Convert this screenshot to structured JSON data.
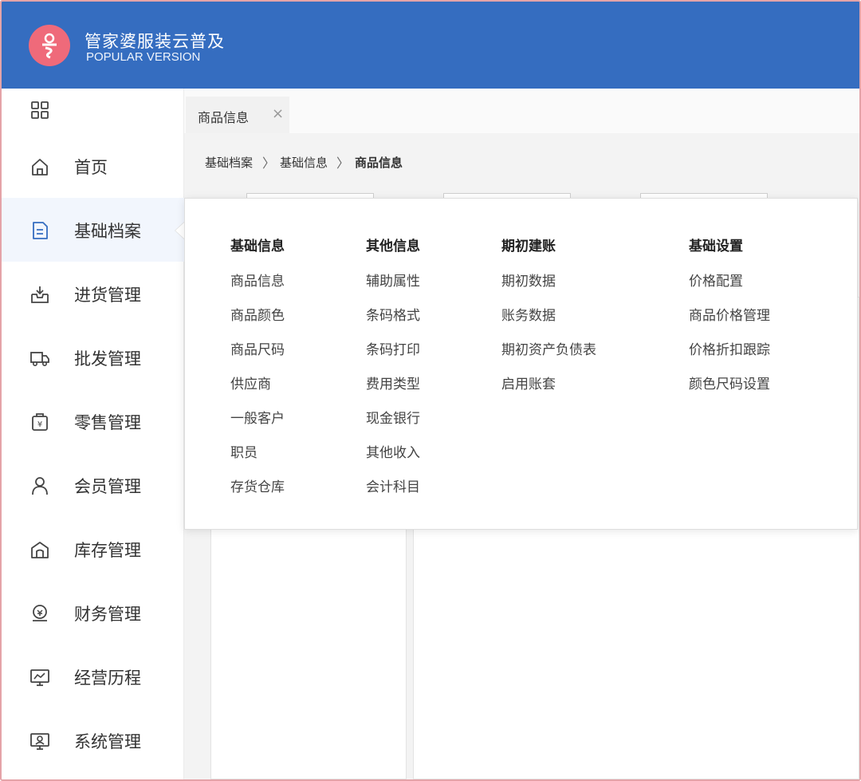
{
  "app": {
    "title": "管家婆服装云普及",
    "subtitle": "POPULAR VERSION",
    "brand_color": "#356dc0",
    "logo_color": "#ef6a7a"
  },
  "sidebar": {
    "items": [
      {
        "label": "首页",
        "icon": "home-icon"
      },
      {
        "label": "基础档案",
        "icon": "document-icon",
        "active": true
      },
      {
        "label": "进货管理",
        "icon": "inbox-download-icon"
      },
      {
        "label": "批发管理",
        "icon": "truck-icon"
      },
      {
        "label": "零售管理",
        "icon": "yen-bag-icon"
      },
      {
        "label": "会员管理",
        "icon": "user-icon"
      },
      {
        "label": "库存管理",
        "icon": "warehouse-icon"
      },
      {
        "label": "财务管理",
        "icon": "finance-icon"
      },
      {
        "label": "经营历程",
        "icon": "chart-monitor-icon"
      },
      {
        "label": "系统管理",
        "icon": "system-monitor-icon"
      }
    ]
  },
  "tabs": [
    {
      "label": "商品信息",
      "close": "×"
    }
  ],
  "breadcrumb": {
    "items": [
      "基础档案",
      "基础信息",
      "商品信息"
    ],
    "separator": "〉"
  },
  "menu": {
    "columns": [
      {
        "title": "基础信息",
        "items": [
          "商品信息",
          "商品颜色",
          "商品尺码",
          "供应商",
          "一般客户",
          "职员",
          "存货仓库"
        ]
      },
      {
        "title": "其他信息",
        "items": [
          "辅助属性",
          "条码格式",
          "条码打印",
          "费用类型",
          "现金银行",
          "其他收入",
          "会计科目"
        ]
      },
      {
        "title": "期初建账",
        "items": [
          "期初数据",
          "账务数据",
          "期初资产负债表",
          "启用账套"
        ]
      },
      {
        "title": "基础设置",
        "items": [
          "价格配置",
          "商品价格管理",
          "价格折扣跟踪",
          "颜色尺码设置"
        ]
      }
    ]
  }
}
